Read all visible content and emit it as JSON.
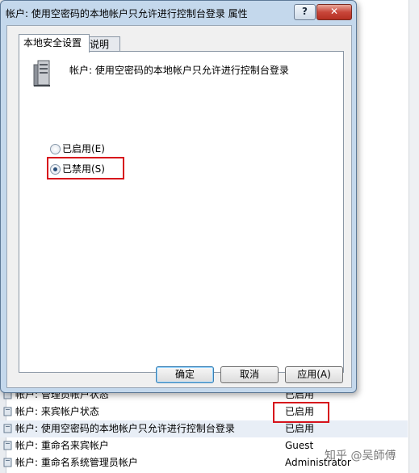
{
  "dialog": {
    "title": "帐户: 使用空密码的本地帐户只允许进行控制台登录 属性",
    "help_glyph": "?",
    "close_glyph": "✕",
    "tabs": [
      {
        "label": "本地安全设置"
      },
      {
        "label": "说明"
      }
    ],
    "policy_title": "帐户: 使用空密码的本地帐户只允许进行控制台登录",
    "options": {
      "enabled": "已启用(E)",
      "disabled": "已禁用(S)",
      "selected": "disabled"
    },
    "buttons": {
      "ok": "确定",
      "cancel": "取消",
      "apply": "应用(A)"
    }
  },
  "background_list": {
    "rows": [
      {
        "name": "帐户: 管理员帐户状态",
        "value": "已启用"
      },
      {
        "name": "帐户: 来宾帐户状态",
        "value": "已启用"
      },
      {
        "name": "帐户: 使用空密码的本地帐户只允许进行控制台登录",
        "value": "已启用"
      },
      {
        "name": "帐户: 重命名来宾帐户",
        "value": "Guest"
      },
      {
        "name": "帐户: 重命名系统管理员帐户",
        "value": "Administrator"
      }
    ]
  },
  "watermark": "知乎 @吴師傅",
  "colors": {
    "highlight_red": "#d7131c",
    "dialog_frame": "#c4d8ec"
  }
}
